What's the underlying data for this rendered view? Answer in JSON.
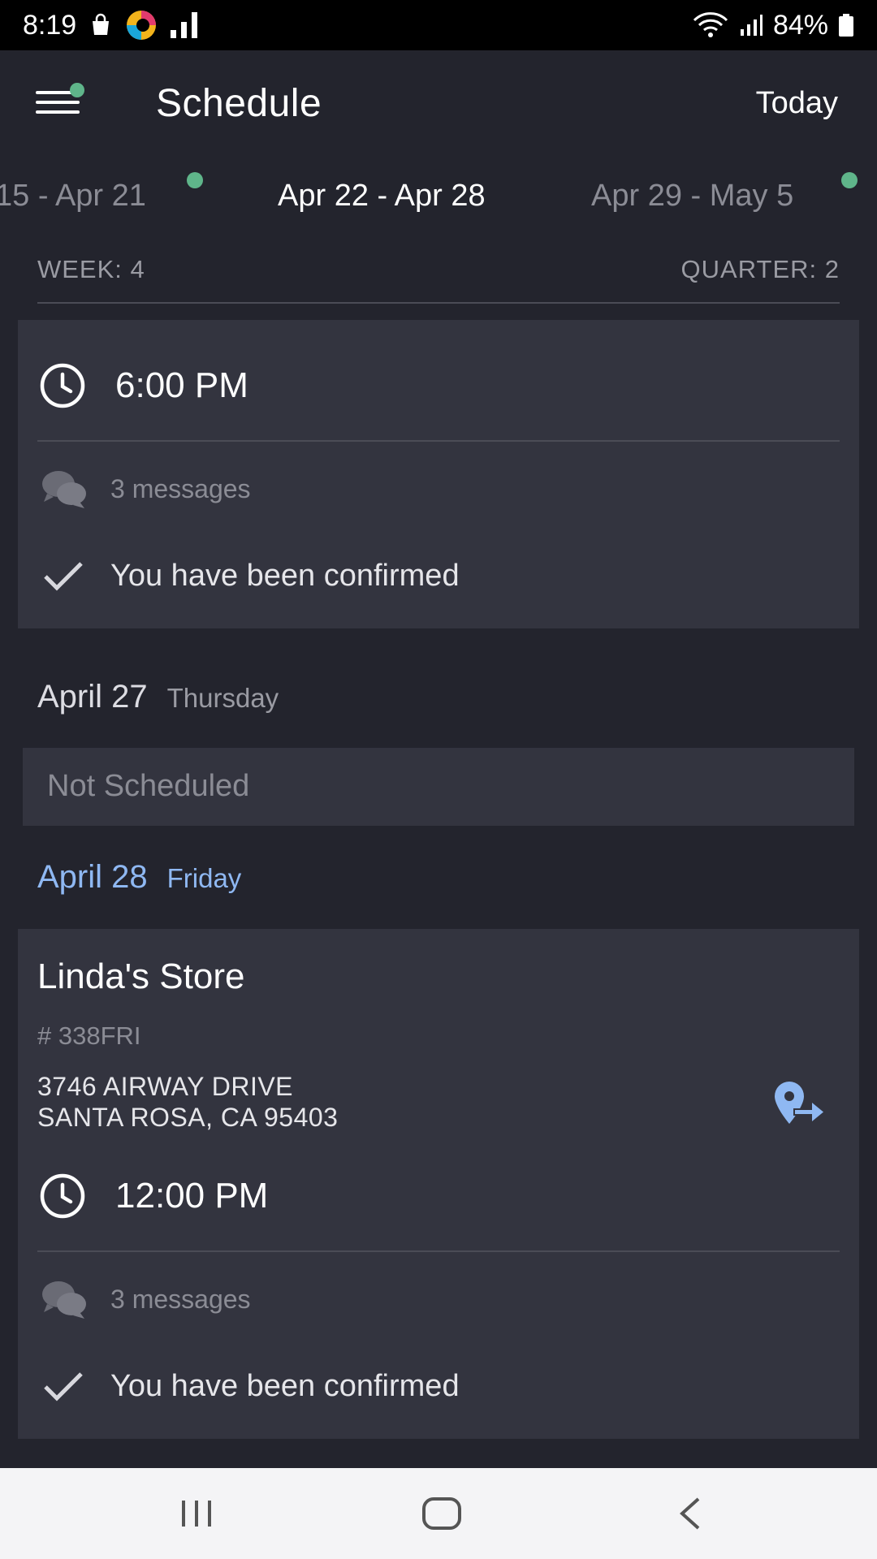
{
  "status_bar": {
    "time": "8:19",
    "battery": "84%"
  },
  "app_bar": {
    "title": "Schedule",
    "today_label": "Today"
  },
  "weeks": {
    "prev": "15 - Apr 21",
    "current": "Apr 22 - Apr 28",
    "next": "Apr 29 - May 5"
  },
  "meta": {
    "week": "WEEK: 4",
    "quarter": "QUARTER: 2"
  },
  "shift_1": {
    "time": "6:00 PM",
    "messages": "3 messages",
    "status": "You have been confirmed"
  },
  "day_27": {
    "date": "April 27",
    "weekday": "Thursday",
    "status": "Not Scheduled"
  },
  "day_28": {
    "date": "April 28",
    "weekday": "Friday"
  },
  "shift_2": {
    "store": "Linda's Store",
    "store_number": "# 338FRI",
    "address_line1": "3746 AIRWAY DRIVE",
    "address_line2": "SANTA ROSA, CA 95403",
    "time": "12:00 PM",
    "messages": "3 messages",
    "status": "You have been confirmed"
  },
  "colors": {
    "background": "#23242d",
    "card": "#33343f",
    "accent": "#8fb8f2",
    "dot": "#5fb58a"
  },
  "icons": [
    "shopping-bag-icon",
    "app-logo-icon",
    "signal-icon",
    "wifi-icon",
    "battery-icon",
    "menu-icon",
    "clock-icon",
    "chat-icon",
    "check-icon",
    "directions-icon",
    "recents-icon",
    "home-icon",
    "back-icon"
  ]
}
